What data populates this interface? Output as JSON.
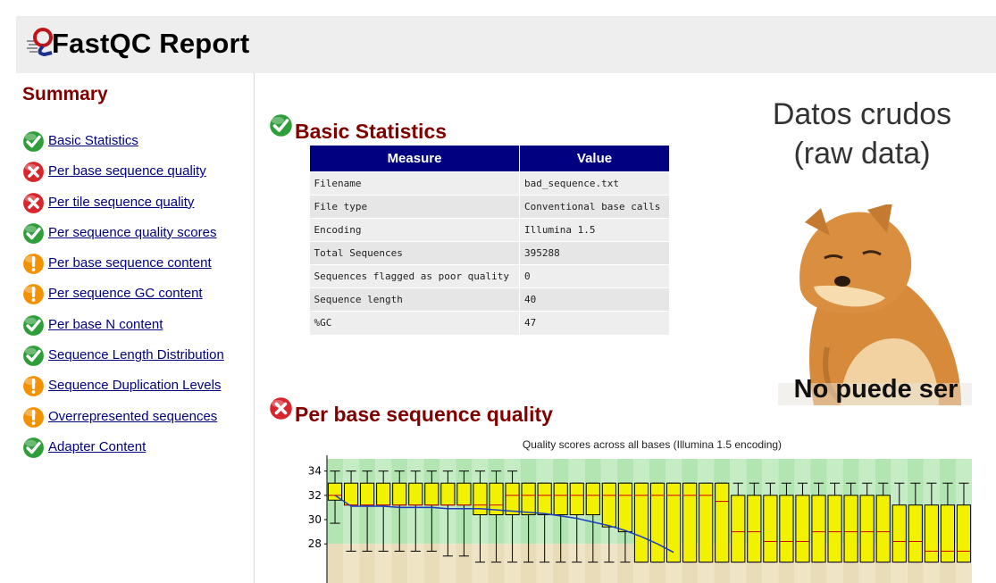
{
  "header": {
    "title": "FastQC Report",
    "logo_icon": "fastqc-logo-icon"
  },
  "sidebar": {
    "title": "Summary",
    "items": [
      {
        "label": "Basic Statistics",
        "status": "pass"
      },
      {
        "label": "Per base sequence quality",
        "status": "fail"
      },
      {
        "label": "Per tile sequence quality",
        "status": "fail"
      },
      {
        "label": "Per sequence quality scores",
        "status": "pass"
      },
      {
        "label": "Per base sequence content",
        "status": "warn"
      },
      {
        "label": "Per sequence GC content",
        "status": "warn"
      },
      {
        "label": "Per base N content",
        "status": "pass"
      },
      {
        "label": "Sequence Length Distribution",
        "status": "pass"
      },
      {
        "label": "Sequence Duplication Levels",
        "status": "warn"
      },
      {
        "label": "Overrepresented sequences",
        "status": "warn"
      },
      {
        "label": "Adapter Content",
        "status": "pass"
      }
    ]
  },
  "status_colors": {
    "pass": "#2e9e3a",
    "warn": "#f39200",
    "fail": "#d7262e"
  },
  "basic_statistics": {
    "title": "Basic Statistics",
    "status": "pass",
    "headers": [
      "Measure",
      "Value"
    ],
    "rows": [
      [
        "Filename",
        "bad_sequence.txt"
      ],
      [
        "File type",
        "Conventional base calls"
      ],
      [
        "Encoding",
        "Illumina 1.5"
      ],
      [
        "Total Sequences",
        "395288"
      ],
      [
        "Sequences flagged as poor quality",
        "0"
      ],
      [
        "Sequence length",
        "40"
      ],
      [
        "%GC",
        "47"
      ]
    ]
  },
  "meme": {
    "caption_line1": "Datos crudos",
    "caption_line2": "(raw data)",
    "image_text": "No puede ser",
    "image_icon": "shiba-dog-meme-image"
  },
  "per_base_quality": {
    "title": "Per base sequence quality",
    "status": "fail"
  },
  "chart_data": {
    "type": "boxplot",
    "title": "Quality scores across all bases (Illumina 1.5 encoding)",
    "ylim": [
      27,
      35
    ],
    "y_ticks": [
      34,
      32,
      30,
      28
    ],
    "band_colors": {
      "good": "#b2e5b2",
      "reasonable": "#e9dcb8"
    },
    "box_color": "#f2f200",
    "median_color": "#d00000",
    "mean_line_color": "#1a3dbf",
    "positions": 40,
    "boxes": [
      {
        "q1": 31.6,
        "q3": 33.0,
        "median": 32.0,
        "low": 29.7,
        "high": 34.0
      },
      {
        "q1": 31.2,
        "q3": 33.0,
        "median": 31.2,
        "low": 27.4,
        "high": 34.0
      },
      {
        "q1": 31.2,
        "q3": 33.0,
        "median": 31.2,
        "low": 27.4,
        "high": 34.0
      },
      {
        "q1": 31.2,
        "q3": 33.0,
        "median": 31.2,
        "low": 27.4,
        "high": 34.0
      },
      {
        "q1": 31.2,
        "q3": 33.0,
        "median": 31.2,
        "low": 27.4,
        "high": 34.0
      },
      {
        "q1": 31.2,
        "q3": 33.0,
        "median": 31.2,
        "low": 27.4,
        "high": 34.0
      },
      {
        "q1": 31.2,
        "q3": 33.0,
        "median": 31.2,
        "low": 27.4,
        "high": 34.0
      },
      {
        "q1": 31.2,
        "q3": 33.0,
        "median": 31.2,
        "low": 27.0,
        "high": 34.0
      },
      {
        "q1": 31.2,
        "q3": 33.0,
        "median": 31.2,
        "low": 27.0,
        "high": 34.0
      },
      {
        "q1": 30.4,
        "q3": 33.0,
        "median": 31.2,
        "low": 26.5,
        "high": 34.0
      },
      {
        "q1": 30.4,
        "q3": 33.0,
        "median": 31.2,
        "low": 26.5,
        "high": 34.0
      },
      {
        "q1": 30.4,
        "q3": 33.0,
        "median": 32.0,
        "low": 26.5,
        "high": 34.0
      },
      {
        "q1": 30.4,
        "q3": 33.0,
        "median": 32.0,
        "low": 26.5,
        "high": 33.0
      },
      {
        "q1": 30.4,
        "q3": 33.0,
        "median": 32.0,
        "low": 26.5,
        "high": 33.0
      },
      {
        "q1": 30.4,
        "q3": 33.0,
        "median": 32.0,
        "low": 26.5,
        "high": 33.0
      },
      {
        "q1": 30.4,
        "q3": 33.0,
        "median": 32.0,
        "low": 26.5,
        "high": 33.0
      },
      {
        "q1": 30.4,
        "q3": 33.0,
        "median": 32.0,
        "low": 26.5,
        "high": 33.0
      },
      {
        "q1": 29.4,
        "q3": 33.0,
        "median": 32.0,
        "low": 26.5,
        "high": 33.0
      },
      {
        "q1": 29.0,
        "q3": 33.0,
        "median": 32.0,
        "low": 26.5,
        "high": 33.0
      },
      {
        "q1": 26.5,
        "q3": 33.0,
        "median": 32.0,
        "low": 26.5,
        "high": 33.0
      },
      {
        "q1": 26.5,
        "q3": 33.0,
        "median": 32.0,
        "low": 26.5,
        "high": 33.0
      },
      {
        "q1": 26.5,
        "q3": 33.0,
        "median": 32.0,
        "low": 26.5,
        "high": 33.0
      },
      {
        "q1": 26.5,
        "q3": 33.0,
        "median": 32.0,
        "low": 26.5,
        "high": 33.0
      },
      {
        "q1": 26.5,
        "q3": 33.0,
        "median": 32.0,
        "low": 26.5,
        "high": 33.0
      },
      {
        "q1": 26.5,
        "q3": 33.0,
        "median": 31.5,
        "low": 26.5,
        "high": 33.0
      },
      {
        "q1": 26.5,
        "q3": 32.0,
        "median": 29.0,
        "low": 26.5,
        "high": 33.0
      },
      {
        "q1": 26.5,
        "q3": 32.0,
        "median": 29.0,
        "low": 26.5,
        "high": 33.0
      },
      {
        "q1": 26.5,
        "q3": 32.0,
        "median": 28.2,
        "low": 26.5,
        "high": 33.0
      },
      {
        "q1": 26.5,
        "q3": 32.0,
        "median": 28.2,
        "low": 26.5,
        "high": 33.0
      },
      {
        "q1": 26.5,
        "q3": 32.0,
        "median": 28.2,
        "low": 26.5,
        "high": 33.0
      },
      {
        "q1": 26.5,
        "q3": 32.0,
        "median": 29.0,
        "low": 26.5,
        "high": 33.0
      },
      {
        "q1": 26.5,
        "q3": 32.0,
        "median": 29.0,
        "low": 26.5,
        "high": 33.0
      },
      {
        "q1": 26.5,
        "q3": 32.0,
        "median": 29.0,
        "low": 26.5,
        "high": 33.0
      },
      {
        "q1": 26.5,
        "q3": 32.0,
        "median": 29.0,
        "low": 26.5,
        "high": 33.0
      },
      {
        "q1": 26.5,
        "q3": 32.0,
        "median": 29.0,
        "low": 26.5,
        "high": 33.0
      },
      {
        "q1": 26.5,
        "q3": 31.2,
        "median": 28.2,
        "low": 26.5,
        "high": 33.0
      },
      {
        "q1": 26.5,
        "q3": 31.2,
        "median": 28.2,
        "low": 26.5,
        "high": 33.0
      },
      {
        "q1": 26.5,
        "q3": 31.2,
        "median": 27.4,
        "low": 26.5,
        "high": 33.0
      },
      {
        "q1": 26.5,
        "q3": 31.2,
        "median": 27.4,
        "low": 26.5,
        "high": 33.0
      },
      {
        "q1": 26.5,
        "q3": 31.2,
        "median": 27.4,
        "low": 26.5,
        "high": 33.0
      }
    ],
    "mean_line": [
      32.0,
      31.1,
      31.1,
      31.1,
      31.0,
      31.0,
      31.0,
      30.9,
      30.9,
      30.9,
      30.8,
      30.7,
      30.6,
      30.5,
      30.3,
      30.1,
      29.8,
      29.5,
      29.1,
      28.6,
      28.0,
      27.3
    ]
  }
}
